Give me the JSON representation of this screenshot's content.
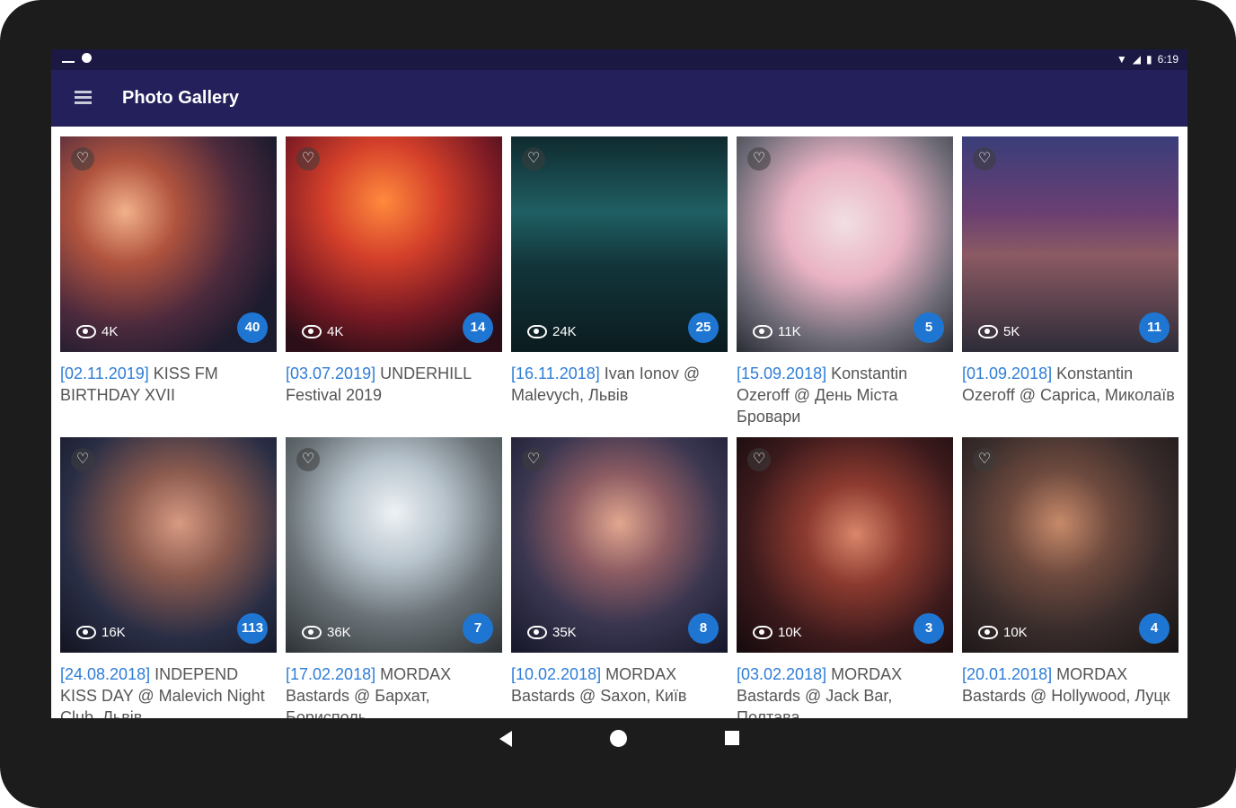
{
  "status_bar": {
    "time": "6:19",
    "icons": [
      "keyboard-icon",
      "notification-icon",
      "wifi-icon",
      "signal-icon",
      "battery-icon"
    ]
  },
  "app_bar": {
    "title": "Photo Gallery",
    "menu_icon": "hamburger-menu-icon"
  },
  "accent_color": "#1f76d2",
  "app_bar_color": "#23205b",
  "gallery": [
    {
      "date": "[02.11.2019]",
      "title": "KISS FM BIRTHDAY XVII",
      "views": "4K",
      "count": "40"
    },
    {
      "date": "[03.07.2019]",
      "title": "UNDERHILL Festival 2019",
      "views": "4K",
      "count": "14"
    },
    {
      "date": "[16.11.2018]",
      "title": "Ivan Ionov @ Malevych, Львів",
      "views": "24K",
      "count": "25"
    },
    {
      "date": "[15.09.2018]",
      "title": "Konstantin Ozeroff @ День Міста Бровари",
      "views": "11K",
      "count": "5"
    },
    {
      "date": "[01.09.2018]",
      "title": "Konstantin Ozeroff @ Caprica, Миколаїв",
      "views": "5K",
      "count": "11"
    },
    {
      "date": "[24.08.2018]",
      "title": "INDEPEND KISS DAY @ Malevich Night Club, Львів",
      "views": "16K",
      "count": "113"
    },
    {
      "date": "[17.02.2018]",
      "title": "MORDAX Bastards @ Бархат, Борисполь",
      "views": "36K",
      "count": "7"
    },
    {
      "date": "[10.02.2018]",
      "title": "MORDAX Bastards @ Saxon, Київ",
      "views": "35K",
      "count": "8"
    },
    {
      "date": "[03.02.2018]",
      "title": "MORDAX Bastards @ Jack Bar, Полтава",
      "views": "10K",
      "count": "3"
    },
    {
      "date": "[20.01.2018]",
      "title": "MORDAX Bastards @ Hollywood, Луцк",
      "views": "10K",
      "count": "4"
    }
  ],
  "nav_bar": {
    "icons": [
      "back-icon",
      "home-icon",
      "recents-icon"
    ]
  }
}
